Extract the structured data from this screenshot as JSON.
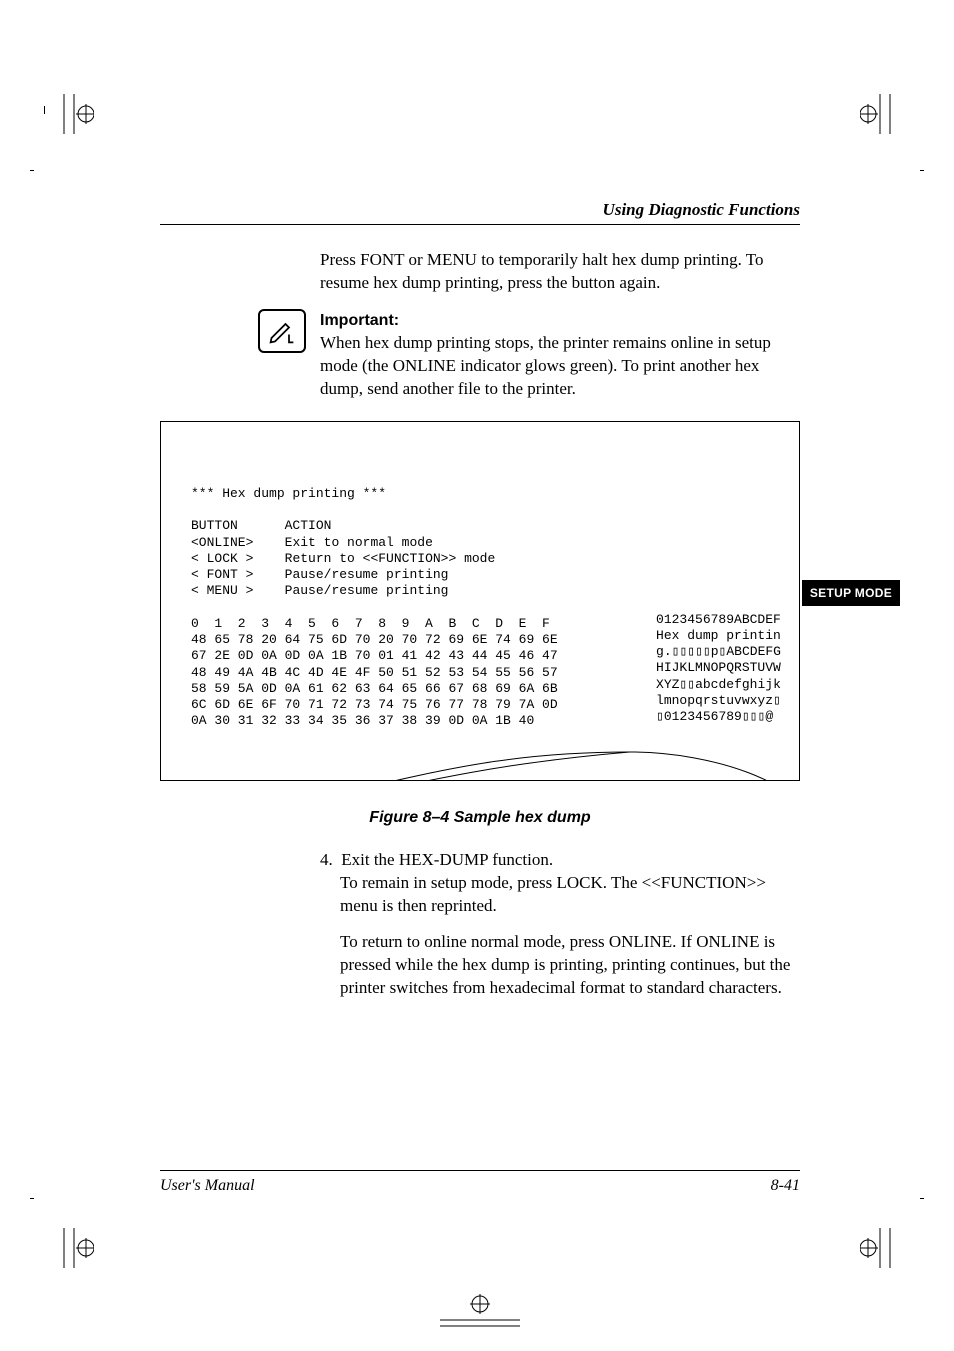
{
  "header": {
    "title": "Using Diagnostic Functions"
  },
  "side_tab": "SETUP MODE",
  "intro": "Press FONT or MENU to temporarily halt hex dump printing. To resume hex dump printing, press the button again.",
  "important": {
    "label": "Important:",
    "text": "When hex dump printing stops, the printer remains online in setup mode (the ONLINE indicator glows green). To print another hex dump, send another file to the printer.",
    "icon": "pen-note-icon"
  },
  "figure": {
    "caption": "Figure 8–4    Sample hex dump",
    "title_line": "*** Hex dump printing ***",
    "header_cols": [
      "BUTTON",
      "ACTION"
    ],
    "actions": [
      {
        "btn": "<ONLINE>",
        "act": "Exit to normal mode"
      },
      {
        "btn": "< LOCK >",
        "act": "Return to <<FUNCTION>> mode"
      },
      {
        "btn": "< FONT >",
        "act": "Pause/resume printing"
      },
      {
        "btn": "< MENU >",
        "act": "Pause/resume printing"
      }
    ],
    "hex_columns": "0  1  2  3  4  5  6  7  8  9  A  B  C  D  E  F",
    "hex_rows": [
      "48 65 78 20 64 75 6D 70 20 70 72 69 6E 74 69 6E",
      "67 2E 0D 0A 0D 0A 1B 70 01 41 42 43 44 45 46 47",
      "48 49 4A 4B 4C 4D 4E 4F 50 51 52 53 54 55 56 57",
      "58 59 5A 0D 0A 61 62 63 64 65 66 67 68 69 6A 6B",
      "6C 6D 6E 6F 70 71 72 73 74 75 76 77 78 79 7A 0D",
      "0A 30 31 32 33 34 35 36 37 38 39 0D 0A 1B 40"
    ],
    "ascii_rows": [
      "0123456789ABCDEF",
      "Hex dump printin",
      "g.▯▯▯▯▯p▯ABCDEFG",
      "HIJKLMNOPQRSTUVW",
      "XYZ▯▯abcdefghijk",
      "lmnopqrstuvwxyz▯",
      "▯0123456789▯▯▯@"
    ]
  },
  "step": {
    "num": "4.",
    "lead": "Exit the HEX-DUMP function.",
    "para1": "To remain in setup mode, press LOCK. The <<FUNCTION>> menu is then reprinted.",
    "para2": "To return to online normal mode, press ONLINE. If ONLINE is pressed while the hex dump is printing, printing continues, but the printer switches from hexadecimal format to standard characters."
  },
  "footer": {
    "left": "User's Manual",
    "right": "8-41"
  }
}
